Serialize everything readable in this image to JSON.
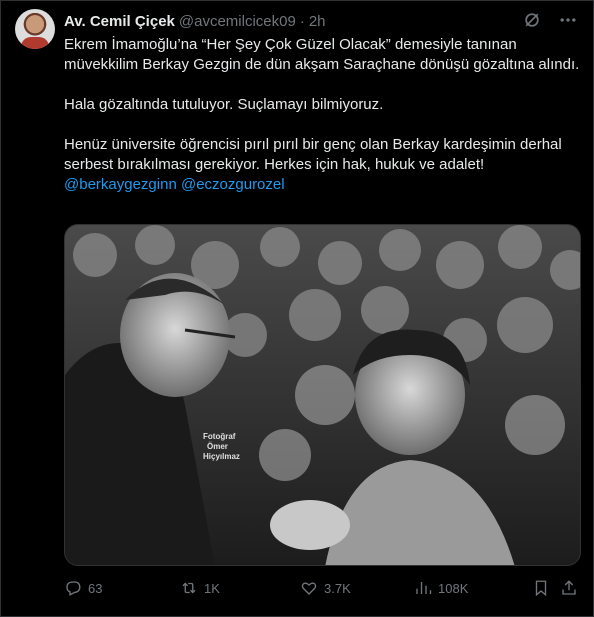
{
  "author": {
    "name": "Av. Cemil Çiçek",
    "handle": "@avcemilcicek09",
    "time": "2h"
  },
  "text": {
    "para1": "Ekrem İmamoğlu’na “Her Şey Çok Güzel Olacak” demesiyle tanınan müvekkilim Berkay Gezgin de dün akşam Saraçhane dönüşü gözaltına alındı.",
    "para2": "Hala gözaltında tutuluyor. Suçlamayı bilmiyoruz.",
    "para3": "Henüz üniversite öğrencisi pırıl pırıl bir genç olan Berkay kardeşimin derhal serbest bırakılması gerekiyor. Herkes için hak, hukuk ve adalet!",
    "mention1": "@berkaygezginn",
    "mention2": "@eczozgurozel"
  },
  "photo": {
    "watermark_line1": "Fotoğraf",
    "watermark_line2": "Ömer",
    "watermark_line3": "Hiçyılmaz"
  },
  "actions": {
    "replies": "63",
    "reposts": "1K",
    "likes": "3.7K",
    "views": "108K"
  },
  "icons": [
    "grok-icon",
    "more-icon",
    "reply-icon",
    "repost-icon",
    "like-icon",
    "views-icon",
    "bookmark-icon",
    "share-icon"
  ]
}
